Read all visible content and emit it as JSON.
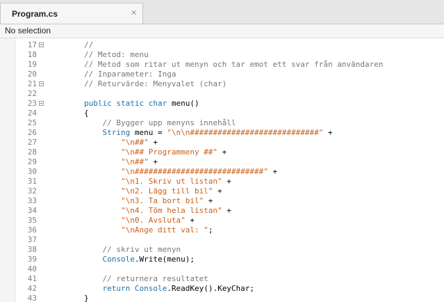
{
  "tab": {
    "title": "Program.cs",
    "close_glyph": "×"
  },
  "status": {
    "text": "No selection"
  },
  "lines": [
    {
      "n": "17",
      "fold": true,
      "tokens": [
        {
          "c": "comment",
          "t": "//"
        }
      ]
    },
    {
      "n": "18",
      "fold": false,
      "tokens": [
        {
          "c": "comment",
          "t": "// Metod: menu"
        }
      ]
    },
    {
      "n": "19",
      "fold": false,
      "tokens": [
        {
          "c": "comment",
          "t": "// Metod som ritar ut menyn och tar emot ett svar från användaren"
        }
      ]
    },
    {
      "n": "20",
      "fold": false,
      "tokens": [
        {
          "c": "comment",
          "t": "// Inparameter: Inga"
        }
      ]
    },
    {
      "n": "21",
      "fold": true,
      "tokens": [
        {
          "c": "comment",
          "t": "// Returvärde: Menyvalet (char)"
        }
      ]
    },
    {
      "n": "22",
      "fold": false,
      "tokens": []
    },
    {
      "n": "23",
      "fold": true,
      "tokens": [
        {
          "c": "kw",
          "t": "public static char "
        },
        {
          "c": "plain",
          "t": "menu()"
        }
      ]
    },
    {
      "n": "24",
      "fold": false,
      "tokens": [
        {
          "c": "plain",
          "t": "{"
        }
      ]
    },
    {
      "n": "25",
      "fold": false,
      "tokens": [
        {
          "c": "comment",
          "t": "    // Bygger upp menyns innehåll"
        }
      ]
    },
    {
      "n": "26",
      "fold": false,
      "tokens": [
        {
          "c": "type",
          "t": "    String "
        },
        {
          "c": "plain",
          "t": "menu = "
        },
        {
          "c": "str",
          "t": "\"\\n\\n############################\""
        },
        {
          "c": "plain",
          "t": " +"
        }
      ]
    },
    {
      "n": "27",
      "fold": false,
      "tokens": [
        {
          "c": "str",
          "t": "        \"\\n##\""
        },
        {
          "c": "plain",
          "t": " +"
        }
      ]
    },
    {
      "n": "28",
      "fold": false,
      "tokens": [
        {
          "c": "str",
          "t": "        \"\\n## Programmeny ##\""
        },
        {
          "c": "plain",
          "t": " +"
        }
      ]
    },
    {
      "n": "29",
      "fold": false,
      "tokens": [
        {
          "c": "str",
          "t": "        \"\\n##\""
        },
        {
          "c": "plain",
          "t": " +"
        }
      ]
    },
    {
      "n": "30",
      "fold": false,
      "tokens": [
        {
          "c": "str",
          "t": "        \"\\n############################\""
        },
        {
          "c": "plain",
          "t": " +"
        }
      ]
    },
    {
      "n": "31",
      "fold": false,
      "tokens": [
        {
          "c": "str",
          "t": "        \"\\n1. Skriv ut listan\""
        },
        {
          "c": "plain",
          "t": " +"
        }
      ]
    },
    {
      "n": "32",
      "fold": false,
      "tokens": [
        {
          "c": "str",
          "t": "        \"\\n2. Lägg till bil\""
        },
        {
          "c": "plain",
          "t": " +"
        }
      ]
    },
    {
      "n": "33",
      "fold": false,
      "tokens": [
        {
          "c": "str",
          "t": "        \"\\n3. Ta bort bil\""
        },
        {
          "c": "plain",
          "t": " +"
        }
      ]
    },
    {
      "n": "34",
      "fold": false,
      "tokens": [
        {
          "c": "str",
          "t": "        \"\\n4. Töm hela listan\""
        },
        {
          "c": "plain",
          "t": " +"
        }
      ]
    },
    {
      "n": "35",
      "fold": false,
      "tokens": [
        {
          "c": "str",
          "t": "        \"\\n0. Avsluta\""
        },
        {
          "c": "plain",
          "t": " +"
        }
      ]
    },
    {
      "n": "36",
      "fold": false,
      "tokens": [
        {
          "c": "str",
          "t": "        \"\\nAnge ditt val: \""
        },
        {
          "c": "plain",
          "t": ";"
        }
      ]
    },
    {
      "n": "37",
      "fold": false,
      "tokens": []
    },
    {
      "n": "38",
      "fold": false,
      "tokens": [
        {
          "c": "comment",
          "t": "    // skriv ut menyn"
        }
      ]
    },
    {
      "n": "39",
      "fold": false,
      "tokens": [
        {
          "c": "type",
          "t": "    Console"
        },
        {
          "c": "plain",
          "t": ".Write(menu);"
        }
      ]
    },
    {
      "n": "40",
      "fold": false,
      "tokens": []
    },
    {
      "n": "41",
      "fold": false,
      "tokens": [
        {
          "c": "comment",
          "t": "    // returnera resultatet"
        }
      ]
    },
    {
      "n": "42",
      "fold": false,
      "tokens": [
        {
          "c": "kw",
          "t": "    return "
        },
        {
          "c": "type",
          "t": "Console"
        },
        {
          "c": "plain",
          "t": ".ReadKey().KeyChar;"
        }
      ]
    },
    {
      "n": "43",
      "fold": false,
      "tokens": [
        {
          "c": "plain",
          "t": "}"
        }
      ]
    }
  ],
  "colors": {
    "comment": "#777777",
    "keyword": "#1f6fa8",
    "string": "#c9601a",
    "text": "#000000"
  }
}
